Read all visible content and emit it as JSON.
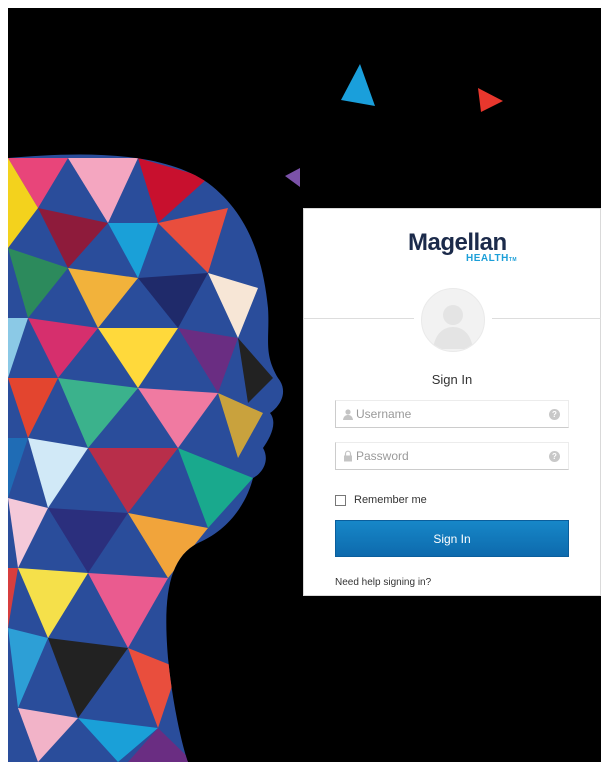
{
  "brand": {
    "name": "Magellan",
    "tagline": "HEALTH",
    "trademark": "TM",
    "colors": {
      "navy": "#1b2a4a",
      "blue": "#1c9fd8"
    }
  },
  "form": {
    "title": "Sign In",
    "username_placeholder": "Username",
    "password_placeholder": "Password",
    "username_icon": "user-icon",
    "password_icon": "lock-icon",
    "help_icon": "help-icon",
    "remember_label": "Remember me",
    "remember_checked": false,
    "submit_label": "Sign In",
    "help_link": "Need help signing in?",
    "button_color": "#1177bd"
  },
  "background": {
    "color": "#000000",
    "decorations": [
      "blue-triangle-icon",
      "red-triangle-icon",
      "purple-triangle-icon",
      "mosaic-head-silhouette"
    ]
  }
}
